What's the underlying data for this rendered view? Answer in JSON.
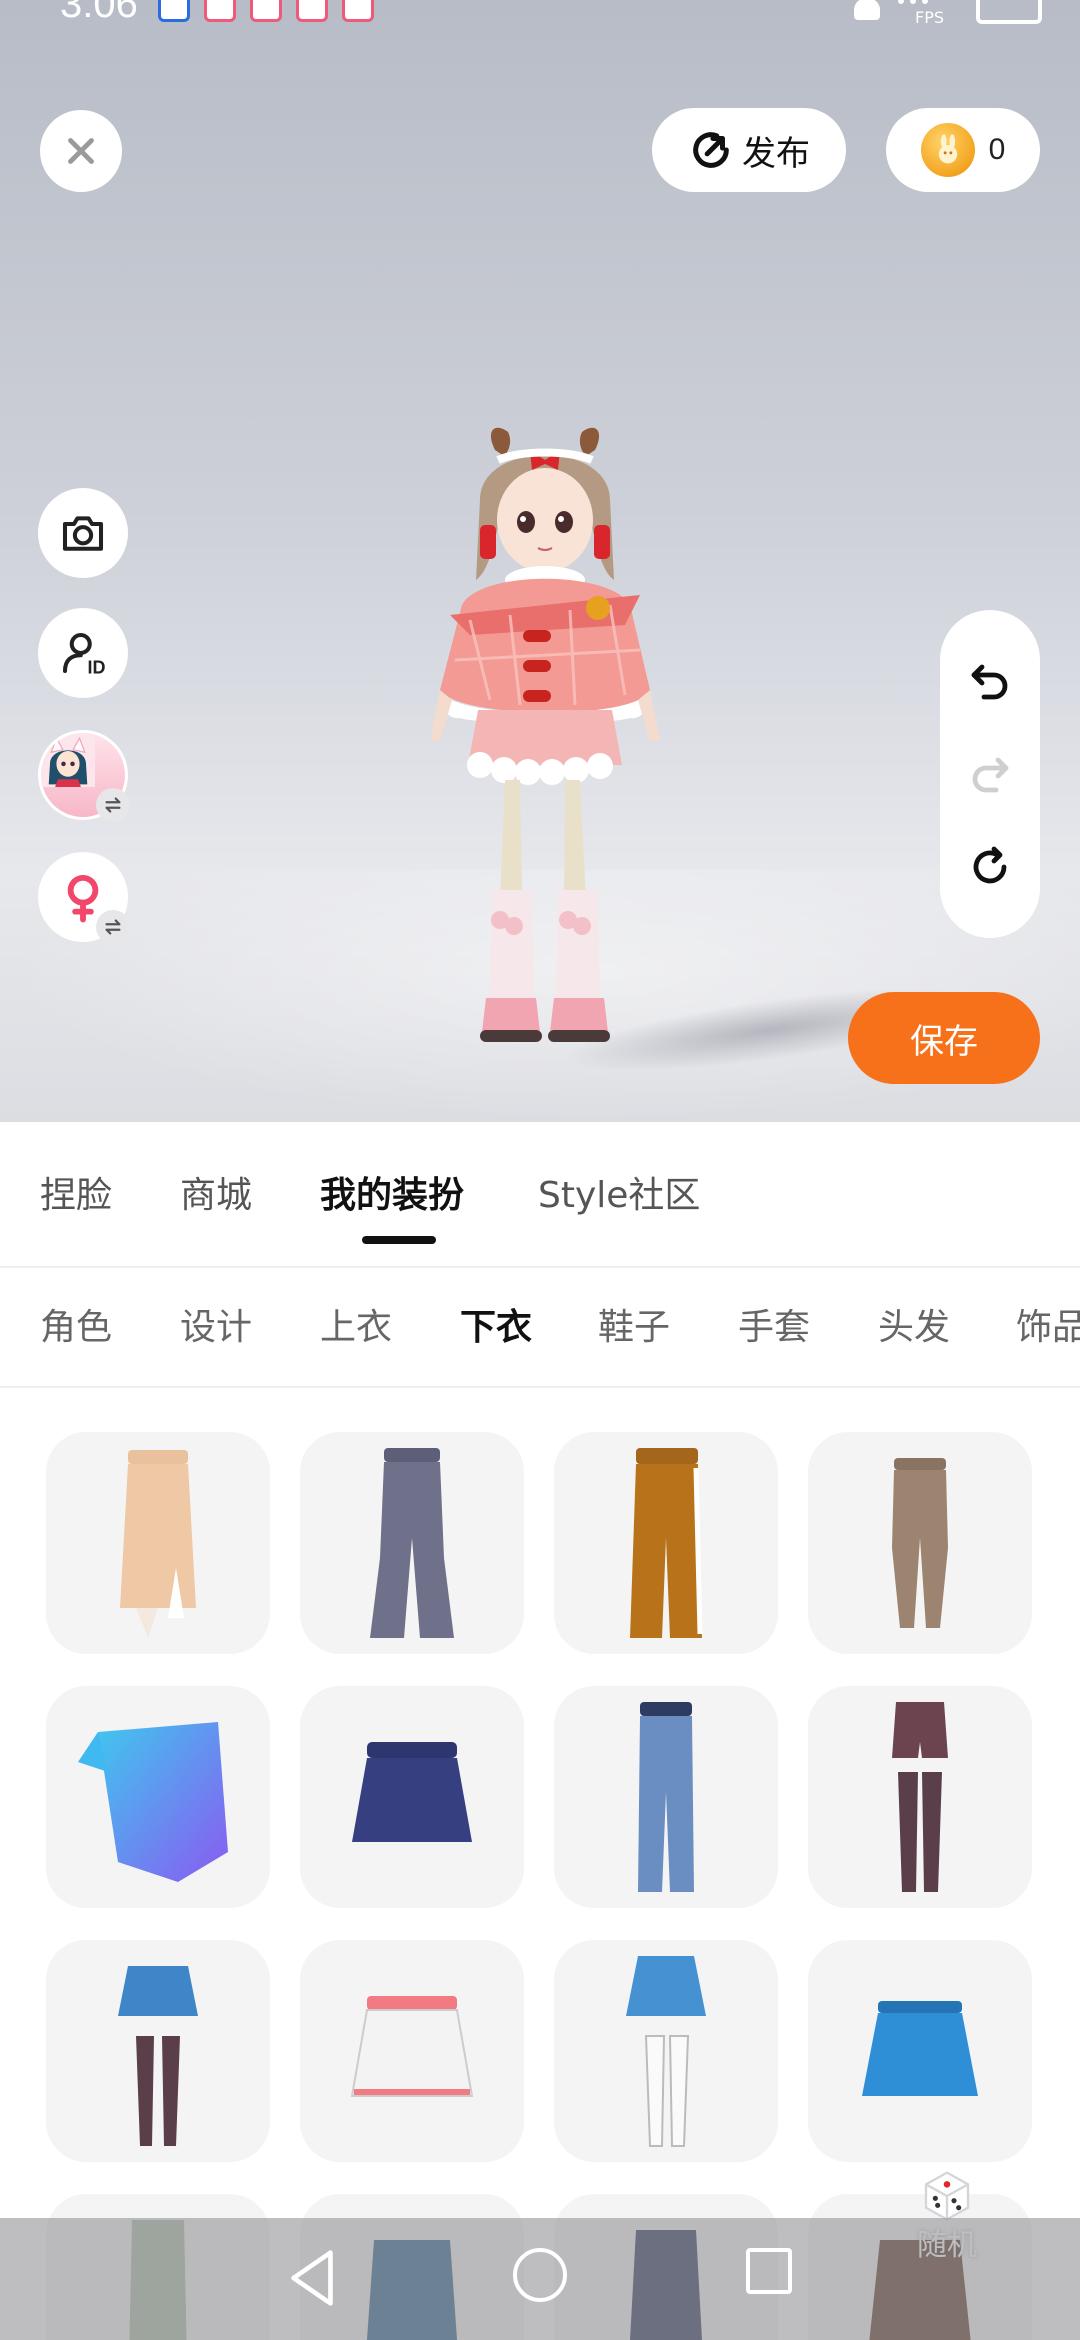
{
  "status_bar": {
    "time": "3:06",
    "fps_label": "FPS"
  },
  "header": {
    "publish_label": "发布",
    "coin_count": "0"
  },
  "side_tools": [
    {
      "name": "camera-icon"
    },
    {
      "name": "user-id-icon"
    },
    {
      "name": "avatar-switch"
    },
    {
      "name": "gender-switch-icon"
    }
  ],
  "history_tools": [
    "undo-icon",
    "redo-icon",
    "reset-icon"
  ],
  "save_label": "保存",
  "main_tabs": [
    {
      "label": "捏脸",
      "active": false
    },
    {
      "label": "商城",
      "active": false
    },
    {
      "label": "我的装扮",
      "active": true
    },
    {
      "label": "Style社区",
      "active": false
    }
  ],
  "sub_tabs": [
    {
      "label": "角色",
      "active": false
    },
    {
      "label": "设计",
      "active": false
    },
    {
      "label": "上衣",
      "active": false
    },
    {
      "label": "下衣",
      "active": true
    },
    {
      "label": "鞋子",
      "active": false
    },
    {
      "label": "手套",
      "active": false
    },
    {
      "label": "头发",
      "active": false
    },
    {
      "label": "饰品",
      "active": false
    }
  ],
  "items": [
    {
      "icon": "beige-slit-skirt-icon",
      "color": "#efc9a6"
    },
    {
      "icon": "gray-flare-pants-icon",
      "color": "#6f7089"
    },
    {
      "icon": "orange-sweatpants-icon",
      "color": "#b8731a"
    },
    {
      "icon": "brown-leggings-icon",
      "color": "#9c8470"
    },
    {
      "icon": "gradient-sarong-icon",
      "color": "#5aa7ef"
    },
    {
      "icon": "navy-mini-skirt-icon",
      "color": "#363f80"
    },
    {
      "icon": "blue-jeans-icon",
      "color": "#6b8ec2"
    },
    {
      "icon": "shorts-stockings-icon",
      "color": "#5a3f4a"
    },
    {
      "icon": "blue-skirt-stockings-icon",
      "color": "#3e86c8"
    },
    {
      "icon": "white-pleated-skirt-icon",
      "color": "#f3f3f3"
    },
    {
      "icon": "blue-skirt-white-socks-icon",
      "color": "#4591d2"
    },
    {
      "icon": "blue-pleated-skirt-icon",
      "color": "#2f8fd6"
    },
    {
      "icon": "green-pencil-skirt-icon",
      "color": "#a9bda2"
    },
    {
      "icon": "teal-skirt-icon",
      "color": "#2b5f8b"
    },
    {
      "icon": "navy-skirt-socks-icon",
      "color": "#283156"
    },
    {
      "icon": "brown-long-skirt-icon",
      "color": "#5a3420"
    }
  ],
  "random_label": "随机"
}
